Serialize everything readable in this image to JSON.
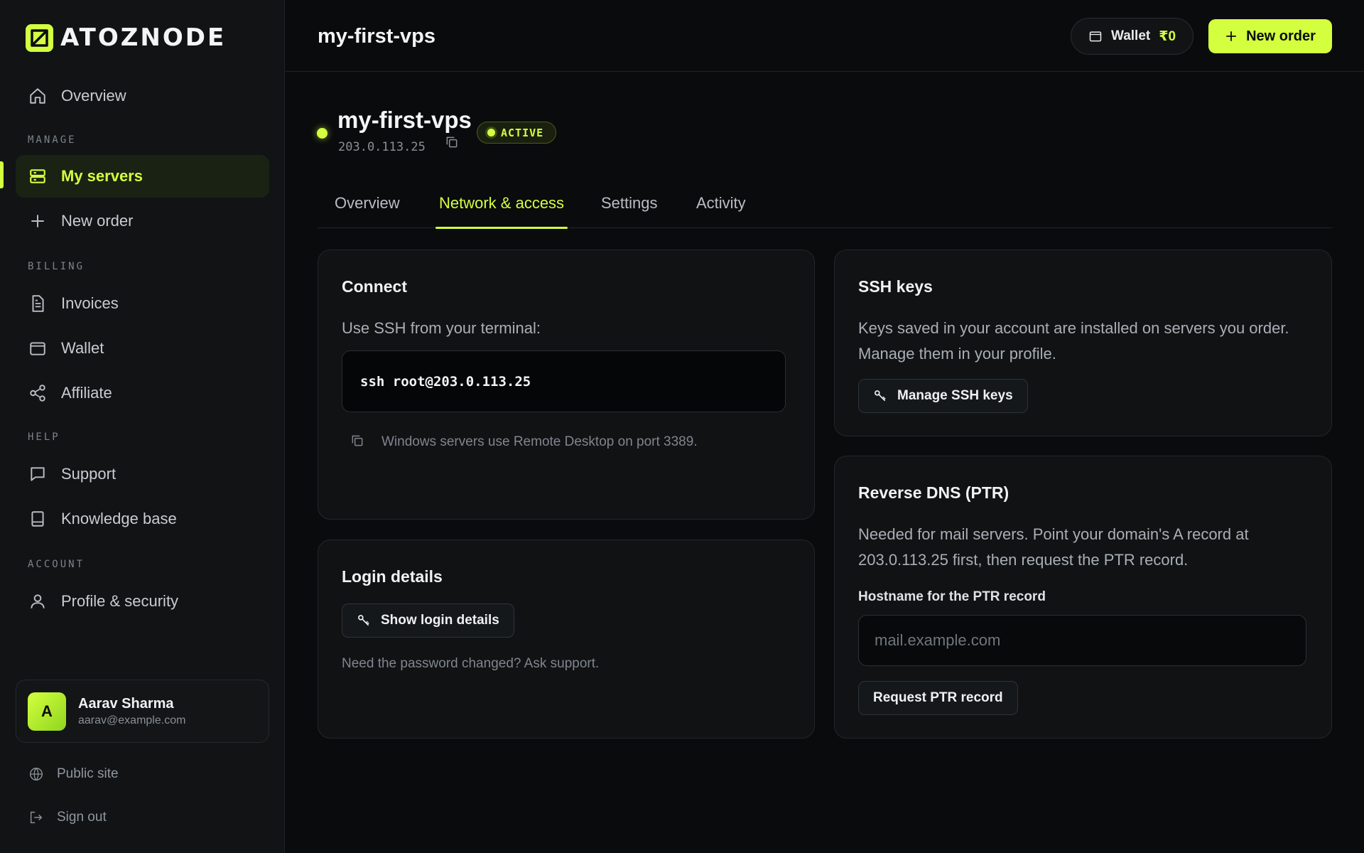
{
  "brand": {
    "name": "ATOZNODE"
  },
  "sidebar": {
    "overview": "Overview",
    "sections": {
      "manage": "MANAGE",
      "billing": "BILLING",
      "help": "HELP",
      "account": "ACCOUNT"
    },
    "items": {
      "my_servers": "My servers",
      "new_order": "New order",
      "invoices": "Invoices",
      "wallet": "Wallet",
      "affiliate": "Affiliate",
      "support": "Support",
      "knowledge_base": "Knowledge base",
      "profile_security": "Profile & security"
    },
    "user": {
      "initial": "A",
      "name": "Aarav Sharma",
      "email": "aarav@example.com"
    },
    "footer": {
      "public_site": "Public site",
      "sign_out": "Sign out"
    }
  },
  "header": {
    "title": "my-first-vps",
    "wallet_label": "Wallet",
    "wallet_amount": "₹0",
    "new_order_label": "New order"
  },
  "server": {
    "name": "my-first-vps",
    "ip": "203.0.113.25",
    "status": "ACTIVE"
  },
  "tabs": [
    "Overview",
    "Network & access",
    "Settings",
    "Activity"
  ],
  "active_tab": "Network & access",
  "connect": {
    "title": "Connect",
    "intro": "Use SSH from your terminal:",
    "command": "ssh root@203.0.113.25",
    "note": "Windows servers use Remote Desktop on port 3389."
  },
  "login": {
    "title": "Login details",
    "button": "Show login details",
    "note": "Need the password changed? Ask support."
  },
  "ssh_keys": {
    "title": "SSH keys",
    "line1": "Keys saved in your account are installed on servers you order.",
    "line2": "Manage them in your profile.",
    "button": "Manage SSH keys"
  },
  "rdns": {
    "title": "Reverse DNS (PTR)",
    "line1": "Needed for mail servers. Point your domain's A record at",
    "line2": "203.0.113.25 first, then request the PTR record.",
    "field_label": "Hostname for the PTR record",
    "placeholder": "mail.example.com",
    "button": "Request PTR record"
  },
  "colors": {
    "accent": "#d4ff3f",
    "background": "#0a0b0d",
    "card": "#101214"
  }
}
